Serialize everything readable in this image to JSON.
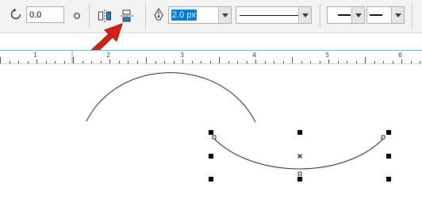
{
  "toolbar": {
    "rotation_value": "0.0",
    "outline_width": "2.0 px"
  },
  "ruler": {
    "labels": [
      "1",
      "2",
      "3",
      "4",
      "5",
      "6"
    ]
  },
  "icons": {
    "rotate": "rotate-icon",
    "rotation_unit": "degree-circle-icon",
    "mirror_horizontal": "mirror-horizontal-icon",
    "align_distribute": "align-distribute-icon",
    "pen": "pen-nib-icon",
    "arrow": "pointer-arrow-icon",
    "object_center": "center-x-icon"
  },
  "colors": {
    "accent_blue": "#48b7d2",
    "selection_blue": "#0078d7",
    "arrow_red": "#d32213"
  }
}
